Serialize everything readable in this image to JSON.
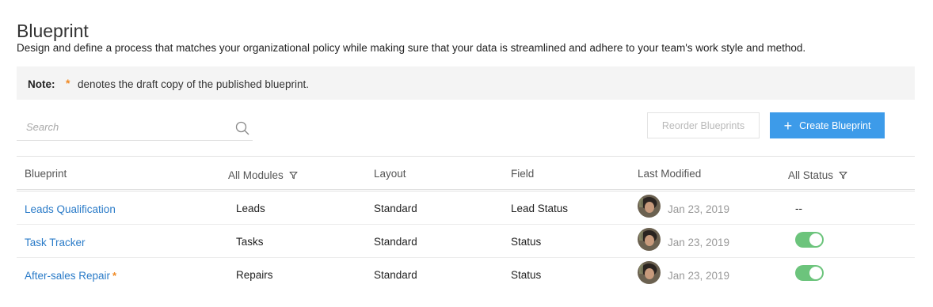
{
  "page": {
    "title": "Blueprint",
    "description": "Design and define a process that matches your organizational policy while making sure that your data is streamlined and adhere to your team's work style and method."
  },
  "note": {
    "label": "Note:",
    "star": "*",
    "text": "denotes the draft copy of the published blueprint."
  },
  "search": {
    "placeholder": "Search",
    "icon": "search-icon"
  },
  "toolbar": {
    "reorder_label": "Reorder Blueprints",
    "create_label": "Create Blueprint",
    "create_icon": "+"
  },
  "table": {
    "headers": {
      "blueprint": "Blueprint",
      "modules": "All Modules",
      "layout": "Layout",
      "field": "Field",
      "last_modified": "Last Modified",
      "status": "All Status"
    },
    "rows": [
      {
        "name": "Leads Qualification",
        "draft": "",
        "module": "Leads",
        "layout": "Standard",
        "field": "Lead Status",
        "modified": "Jan 23, 2019",
        "status": "--",
        "active": false
      },
      {
        "name": "Task Tracker",
        "draft": "",
        "module": "Tasks",
        "layout": "Standard",
        "field": "Status",
        "modified": "Jan 23, 2019",
        "status": "",
        "active": true
      },
      {
        "name": "After-sales Repair",
        "draft": "*",
        "module": "Repairs",
        "layout": "Standard",
        "field": "Status",
        "modified": "Jan 23, 2019",
        "status": "",
        "active": true
      }
    ]
  },
  "colors": {
    "accent": "#3d9be9",
    "link": "#2a7bc8",
    "draft": "#f08a24",
    "toggle_on": "#6cc47c"
  }
}
